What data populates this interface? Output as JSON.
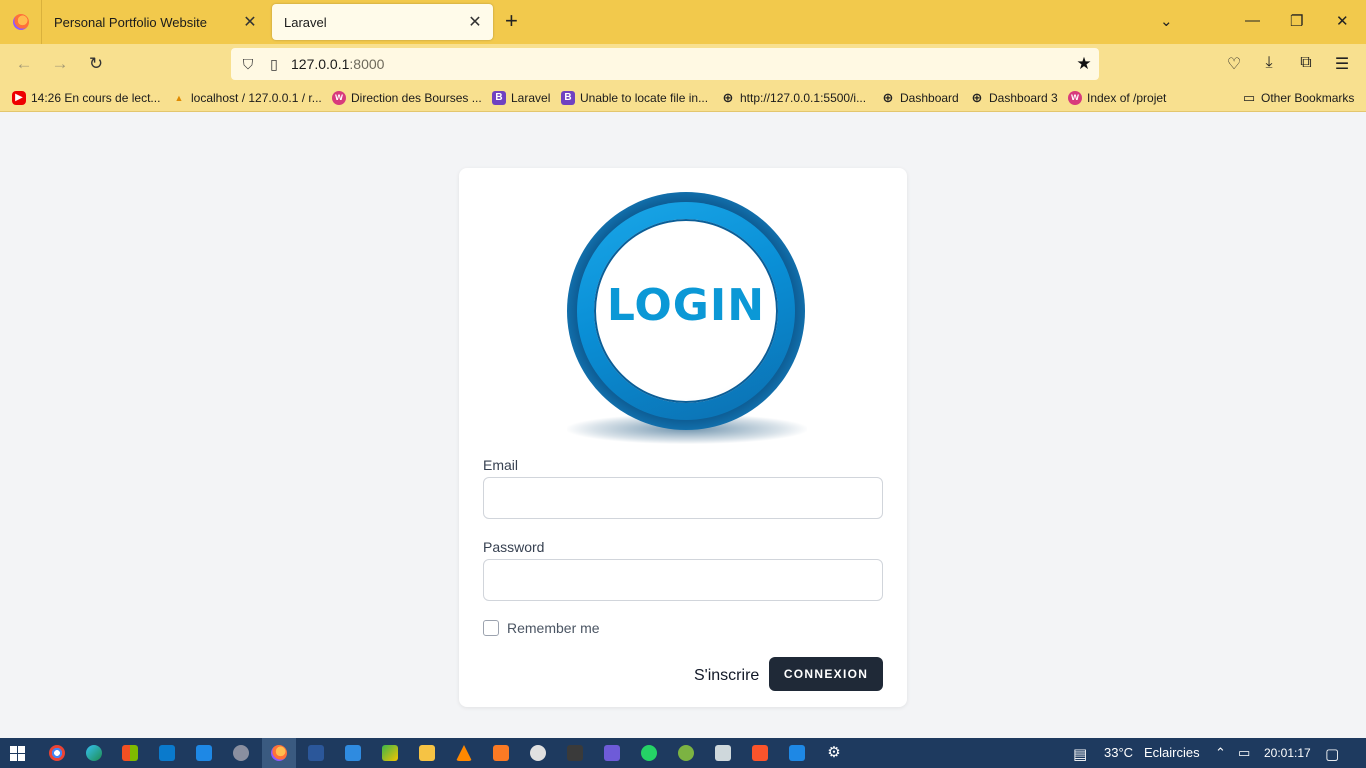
{
  "tabs": [
    {
      "title": "Personal Portfolio Website",
      "active": false
    },
    {
      "title": "Laravel",
      "active": true
    }
  ],
  "url": {
    "host": "127.0.0.1",
    "port": ":8000"
  },
  "bookmarks": [
    {
      "label": "14:26  En cours de lect...",
      "icon": "youtube-icon"
    },
    {
      "label": "localhost / 127.0.0.1 / r...",
      "icon": "phpmyadmin-icon"
    },
    {
      "label": "Direction des Bourses ...",
      "icon": "site-icon"
    },
    {
      "label": "Laravel",
      "icon": "bootstrap-icon"
    },
    {
      "label": "Unable to locate file in...",
      "icon": "bootstrap-icon"
    },
    {
      "label": "http://127.0.0.1:5500/i...",
      "icon": "globe-icon"
    },
    {
      "label": "Dashboard",
      "icon": "globe-icon"
    },
    {
      "label": "Dashboard 3",
      "icon": "globe-icon"
    },
    {
      "label": "Index of /projet",
      "icon": "site-icon"
    },
    {
      "label": "Other Bookmarks",
      "icon": "folder-icon"
    }
  ],
  "login": {
    "logo_text": "LOGIN",
    "email_label": "Email",
    "email_value": "",
    "password_label": "Password",
    "password_value": "",
    "remember_label": "Remember me",
    "register_link": "S'inscrire",
    "submit_label": "CONNEXION"
  },
  "taskbar": {
    "temperature": "33°C",
    "weather": "Eclaircies",
    "time": "20:01:17"
  },
  "colors": {
    "tabstrip": "#f2c94c",
    "toolbar": "#f8e08f",
    "button_dark": "#1f2937",
    "logo_blue": "#0b98d6",
    "taskbar": "#1e3a5f"
  }
}
